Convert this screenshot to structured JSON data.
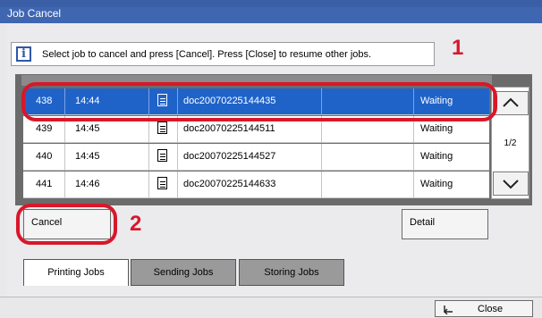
{
  "window": {
    "title": "Job Cancel"
  },
  "message": {
    "text": "Select job to cancel and press [Cancel]. Press [Close] to resume other jobs."
  },
  "callouts": {
    "one": "1",
    "two": "2"
  },
  "jobs": [
    {
      "no": "438",
      "time": "14:44",
      "icon": "doc-icon",
      "name": "doc20070225144435",
      "status": "Waiting",
      "selected": true
    },
    {
      "no": "439",
      "time": "14:45",
      "icon": "doc-icon",
      "name": "doc20070225144511",
      "status": "Waiting",
      "selected": false
    },
    {
      "no": "440",
      "time": "14:45",
      "icon": "doc-icon",
      "name": "doc20070225144527",
      "status": "Waiting",
      "selected": false
    },
    {
      "no": "441",
      "time": "14:46",
      "icon": "doc-icon",
      "name": "doc20070225144633",
      "status": "Waiting",
      "selected": false
    }
  ],
  "pager": {
    "page": "1/2"
  },
  "buttons": {
    "cancel": "Cancel",
    "detail": "Detail",
    "close": "Close"
  },
  "tabs": [
    {
      "label": "Printing Jobs",
      "active": true
    },
    {
      "label": "Sending Jobs",
      "active": false
    },
    {
      "label": "Storing Jobs",
      "active": false
    }
  ],
  "colors": {
    "titlebar": "#3f66b1",
    "selection": "#1f63c9",
    "highlight_ring": "#d8172a"
  }
}
